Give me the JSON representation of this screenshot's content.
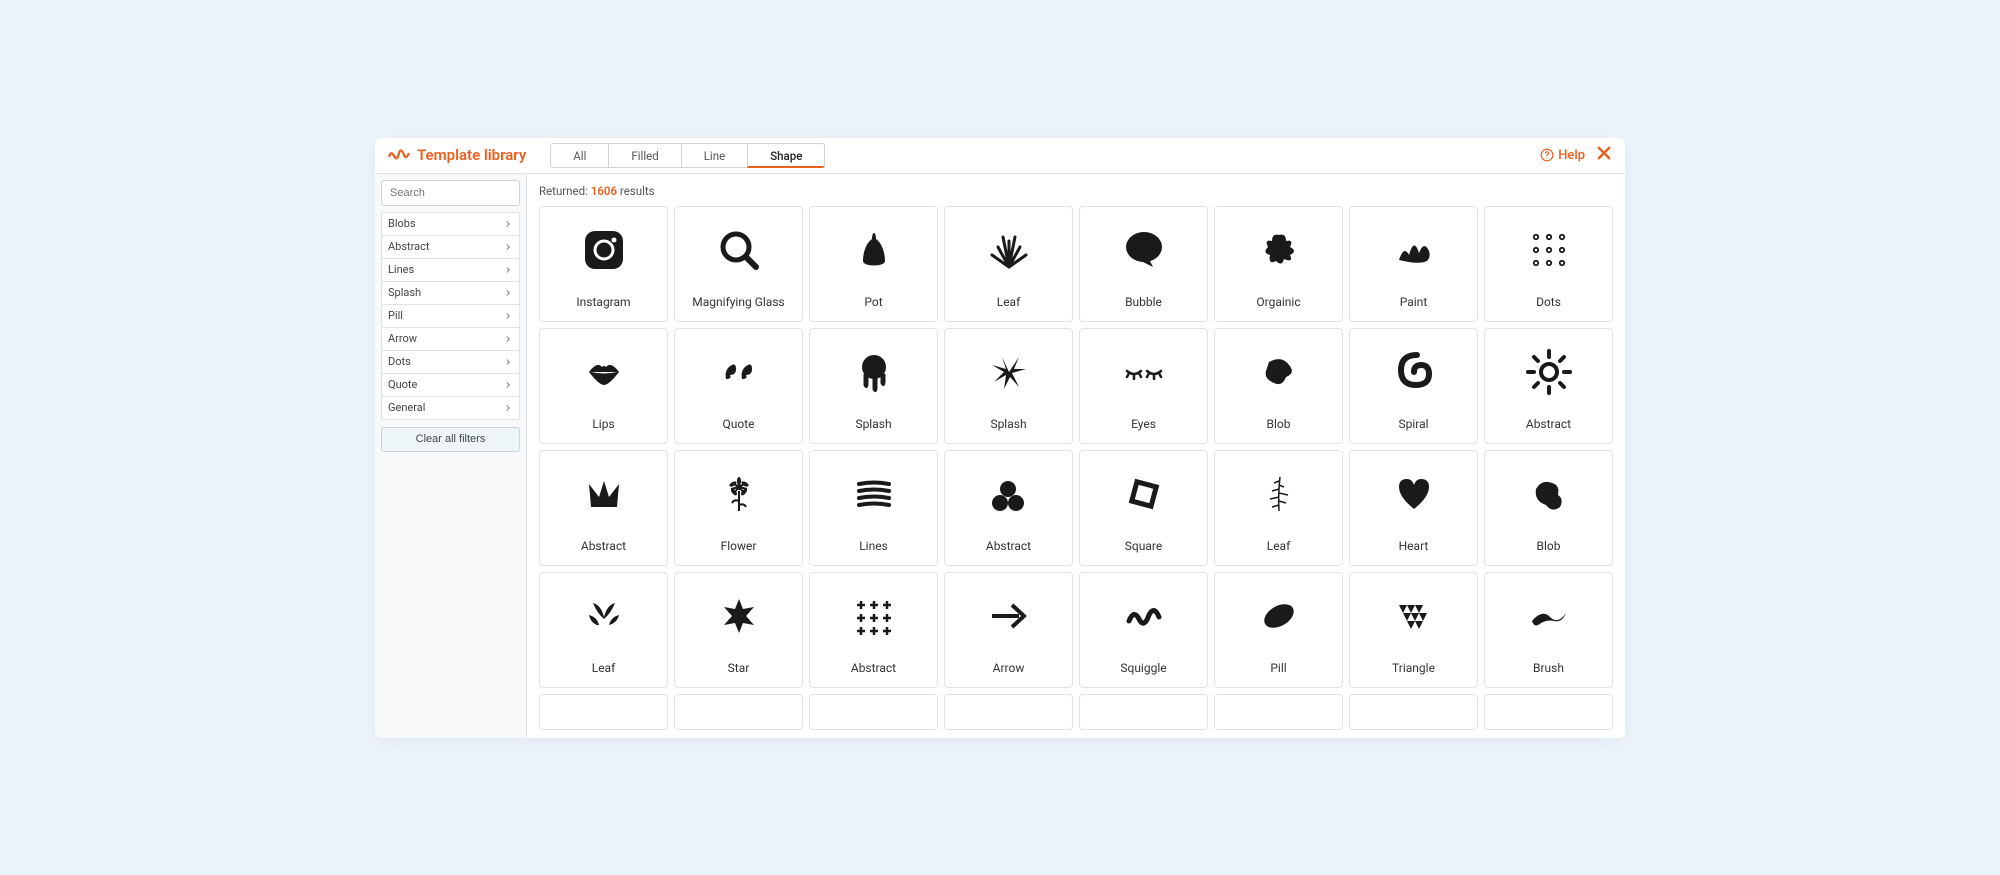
{
  "header": {
    "title": "Template library",
    "tabs": [
      "All",
      "Filled",
      "Line",
      "Shape"
    ],
    "active_tab": "Shape",
    "help_label": "Help"
  },
  "sidebar": {
    "search_placeholder": "Search",
    "filters": [
      "Blobs",
      "Abstract",
      "Lines",
      "Splash",
      "Pill",
      "Arrow",
      "Dots",
      "Quote",
      "General"
    ],
    "clear_label": "Clear all filters"
  },
  "results": {
    "prefix": "Returned:",
    "count": "1606",
    "suffix": "results"
  },
  "items": [
    {
      "label": "Instagram",
      "icon": "instagram"
    },
    {
      "label": "Magnifying Glass",
      "icon": "magnify"
    },
    {
      "label": "Pot",
      "icon": "pot"
    },
    {
      "label": "Leaf",
      "icon": "grass"
    },
    {
      "label": "Bubble",
      "icon": "bubble"
    },
    {
      "label": "Orgainic",
      "icon": "splat"
    },
    {
      "label": "Paint",
      "icon": "paint"
    },
    {
      "label": "Dots",
      "icon": "dots"
    },
    {
      "label": "Lips",
      "icon": "lips"
    },
    {
      "label": "Quote",
      "icon": "quote"
    },
    {
      "label": "Splash",
      "icon": "drip"
    },
    {
      "label": "Splash",
      "icon": "splash"
    },
    {
      "label": "Eyes",
      "icon": "eyes"
    },
    {
      "label": "Blob",
      "icon": "blob1"
    },
    {
      "label": "Spiral",
      "icon": "spiral"
    },
    {
      "label": "Abstract",
      "icon": "sun"
    },
    {
      "label": "Abstract",
      "icon": "crown"
    },
    {
      "label": "Flower",
      "icon": "flower"
    },
    {
      "label": "Lines",
      "icon": "lines"
    },
    {
      "label": "Abstract",
      "icon": "pebbles"
    },
    {
      "label": "Square",
      "icon": "square"
    },
    {
      "label": "Leaf",
      "icon": "fern"
    },
    {
      "label": "Heart",
      "icon": "heart"
    },
    {
      "label": "Blob",
      "icon": "blob2"
    },
    {
      "label": "Leaf",
      "icon": "leaves"
    },
    {
      "label": "Star",
      "icon": "starburst"
    },
    {
      "label": "Abstract",
      "icon": "plusgrid"
    },
    {
      "label": "Arrow",
      "icon": "arrow"
    },
    {
      "label": "Squiggle",
      "icon": "squiggle"
    },
    {
      "label": "Pill",
      "icon": "pill"
    },
    {
      "label": "Triangle",
      "icon": "trigrid"
    },
    {
      "label": "Brush",
      "icon": "brush"
    }
  ]
}
